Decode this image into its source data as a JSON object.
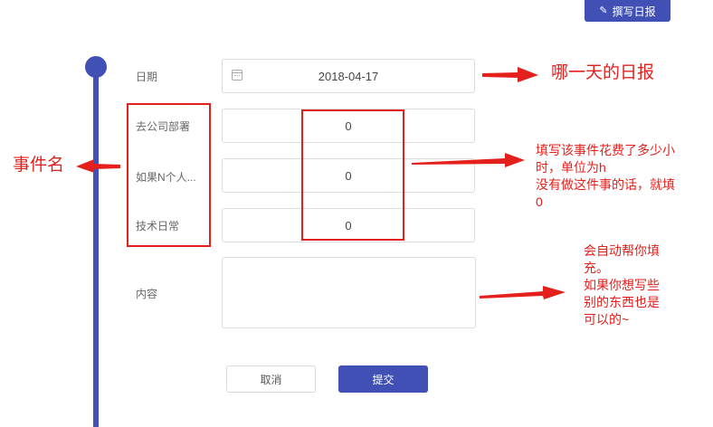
{
  "header": {
    "write_report_label": "撰写日报"
  },
  "form": {
    "date_label": "日期",
    "date_value": "2018-04-17",
    "rows": [
      {
        "label": "去公司部署",
        "value": "0"
      },
      {
        "label": "如果N个人...",
        "value": "0"
      },
      {
        "label": "技术日常",
        "value": "0"
      }
    ],
    "content_label": "内容",
    "cancel_label": "取消",
    "submit_label": "提交"
  },
  "annotations": {
    "date_note": "哪一天的日报",
    "event_name_note": "事件名",
    "hours_note": [
      "填写该事件花费了多少小",
      "时，单位为h",
      "没有做这件事的话，就填",
      "0"
    ],
    "content_note": [
      "会自动帮你填",
      "充。",
      "如果你想写些",
      "别的东西也是",
      "可以的~"
    ],
    "accent_color": "#4150b5",
    "annotation_color": "#e4201c"
  }
}
